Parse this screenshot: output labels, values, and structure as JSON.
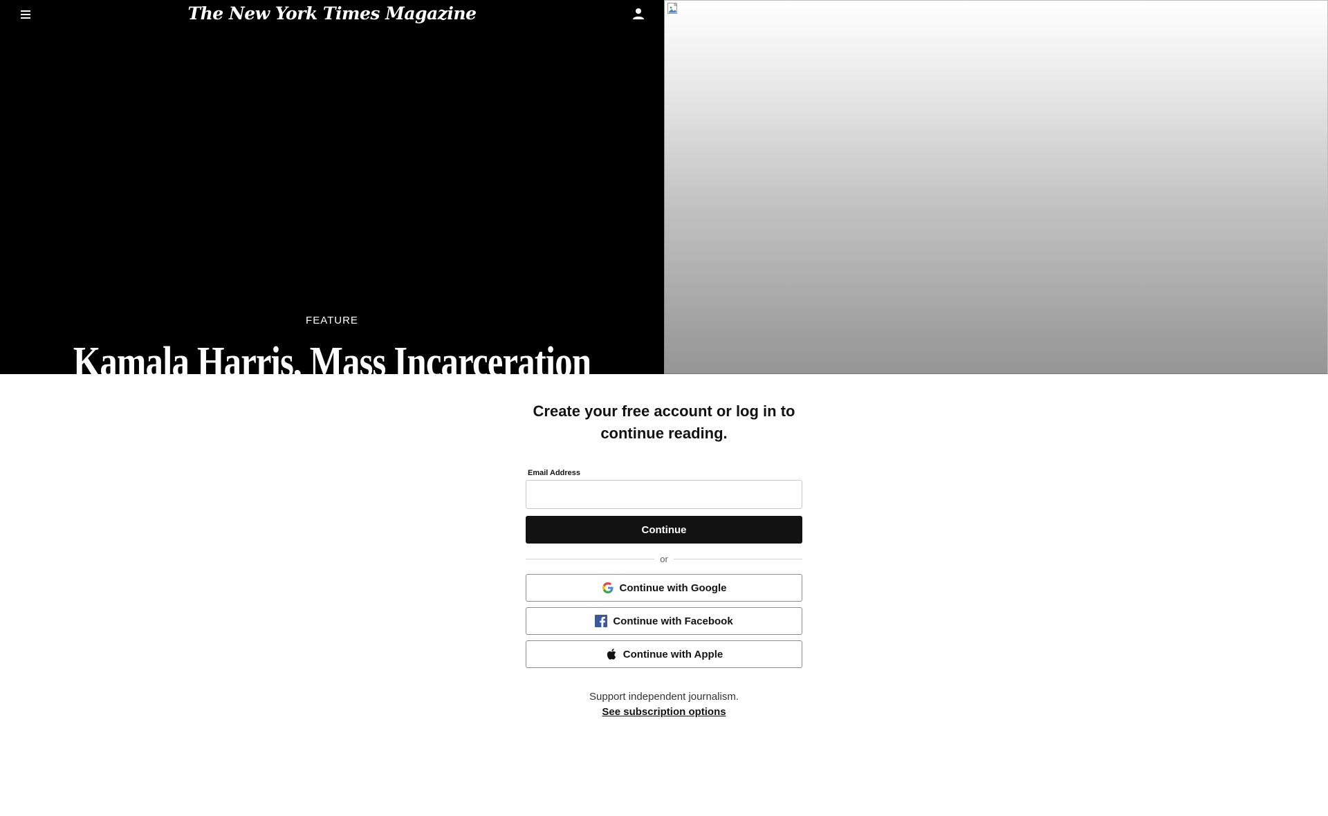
{
  "header": {
    "masthead": "The New York Times Magazine",
    "menu_icon": "hamburger-menu-icon",
    "account_icon": "person-icon"
  },
  "article": {
    "kicker": "FEATURE",
    "headline": "Kamala Harris, Mass Incarceration"
  },
  "hero_image": {
    "icon": "broken-image-icon"
  },
  "login": {
    "heading": "Create your free account or log in to continue reading.",
    "email_label": "Email Address",
    "email_value": "",
    "continue_label": "Continue",
    "or_label": "or",
    "google_label": "Continue with Google",
    "facebook_label": "Continue with Facebook",
    "apple_label": "Continue with Apple",
    "support_text": "Support independent journalism.",
    "subscription_link": "See subscription options"
  },
  "colors": {
    "primary_button": "#121212",
    "facebook_blue": "#3b5998",
    "hero_background": "#000000"
  }
}
